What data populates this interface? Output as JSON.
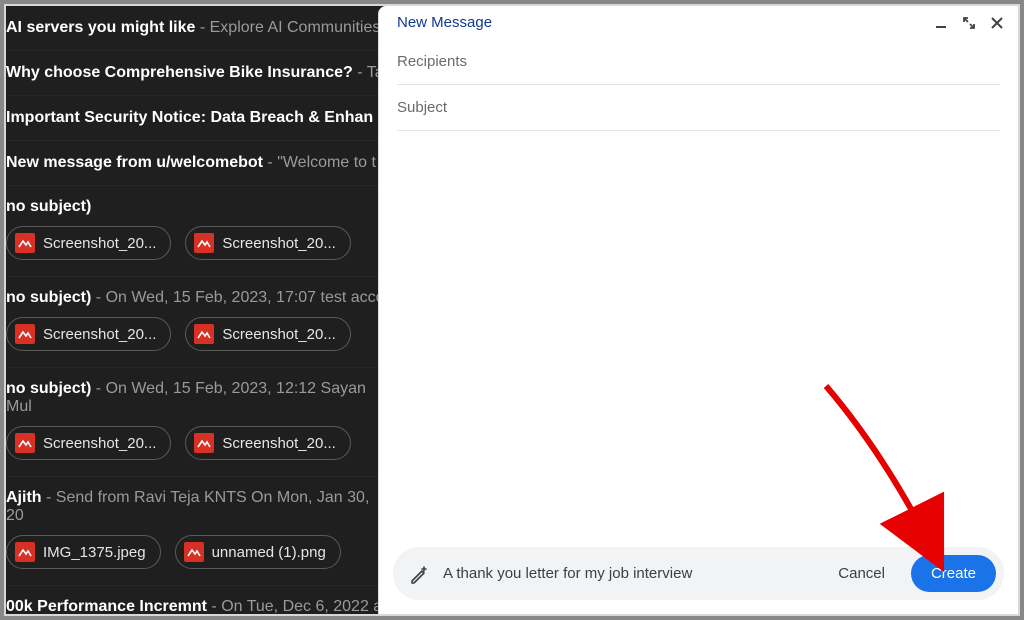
{
  "inbox": {
    "rows": [
      {
        "subject": "AI servers you might like",
        "preview": " - Explore AI Communities"
      },
      {
        "subject": "Why choose Comprehensive Bike Insurance?",
        "preview": " - Ta"
      },
      {
        "subject": "Important Security Notice: Data Breach & Enhan",
        "preview": ""
      },
      {
        "subject": "New message from u/welcomebot",
        "preview": " - \"Welcome to t"
      }
    ],
    "blocks": [
      {
        "subject": "no subject)",
        "preview": "",
        "attachments": [
          "Screenshot_20...",
          "Screenshot_20..."
        ]
      },
      {
        "subject": "no subject)",
        "preview": " - On Wed, 15 Feb, 2023, 17:07 test acco",
        "attachments": [
          "Screenshot_20...",
          "Screenshot_20..."
        ]
      },
      {
        "subject": "no subject)",
        "preview": " - On Wed, 15 Feb, 2023, 12:12 Sayan Mul",
        "attachments": [
          "Screenshot_20...",
          "Screenshot_20..."
        ]
      },
      {
        "subject": "Ajith",
        "preview": " - Send from Ravi Teja KNTS On Mon, Jan 30, 20",
        "attachments": [
          "IMG_1375.jpeg",
          "unnamed (1).png"
        ]
      },
      {
        "subject": "00k Performance Incremnt",
        "preview": " - On Tue, Dec 6, 2022 a",
        "attachments": []
      }
    ]
  },
  "compose": {
    "title": "New Message",
    "recipients_placeholder": "Recipients",
    "subject_placeholder": "Subject",
    "ai_prompt": "A thank you letter for my job interview",
    "cancel_label": "Cancel",
    "create_label": "Create"
  }
}
